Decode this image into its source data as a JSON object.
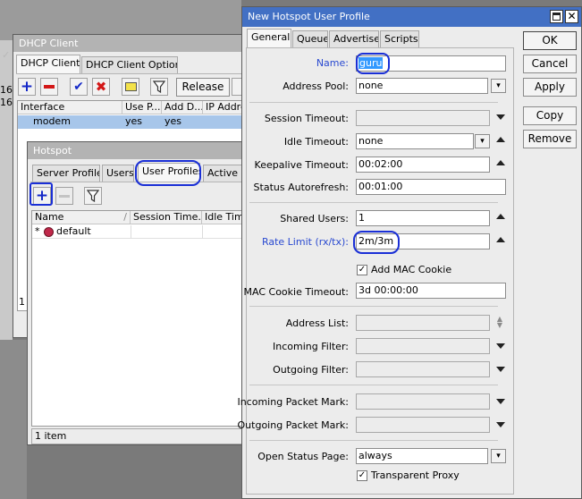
{
  "dhcp": {
    "title": "DHCP Client",
    "tabs": [
      "DHCP Client",
      "DHCP Client Options"
    ],
    "release_label": "Release",
    "columns": [
      "Interface",
      "Use P...",
      "Add D...",
      "IP Address"
    ],
    "row": [
      "modem",
      "yes",
      "yes",
      ""
    ],
    "edge_digits": [
      "16",
      "16"
    ],
    "footer_digit": "1"
  },
  "hotspot": {
    "title": "Hotspot",
    "tabs": [
      "Server Profiles",
      "Users",
      "User Profiles",
      "Active"
    ],
    "columns": [
      "Name",
      "Session Time...",
      "Idle Time"
    ],
    "row_marker": "*",
    "row_name": "default",
    "status": "1 item"
  },
  "dialog": {
    "title": "New Hotspot User Profile",
    "tabs": [
      "General",
      "Queue",
      "Advertise",
      "Scripts"
    ],
    "buttons": [
      "OK",
      "Cancel",
      "Apply",
      "Copy",
      "Remove"
    ],
    "labels": {
      "name": "Name:",
      "address_pool": "Address Pool:",
      "session_timeout": "Session Timeout:",
      "idle_timeout": "Idle Timeout:",
      "keepalive_timeout": "Keepalive Timeout:",
      "status_autorefresh": "Status Autorefresh:",
      "shared_users": "Shared Users:",
      "rate_limit": "Rate Limit (rx/tx):",
      "add_mac_cookie": "Add MAC Cookie",
      "mac_cookie_timeout": "MAC Cookie Timeout:",
      "address_list": "Address List:",
      "incoming_filter": "Incoming Filter:",
      "outgoing_filter": "Outgoing Filter:",
      "incoming_packet_mark": "Incoming Packet Mark:",
      "outgoing_packet_mark": "Outgoing Packet Mark:",
      "open_status_page": "Open Status Page:",
      "transparent_proxy": "Transparent Proxy"
    },
    "values": {
      "name": "guru",
      "address_pool": "none",
      "session_timeout": "",
      "idle_timeout": "none",
      "keepalive_timeout": "00:02:00",
      "status_autorefresh": "00:01:00",
      "shared_users": "1",
      "rate_limit": "2m/3m",
      "add_mac_cookie": true,
      "mac_cookie_timeout": "3d 00:00:00",
      "address_list": "",
      "incoming_filter": "",
      "outgoing_filter": "",
      "incoming_packet_mark": "",
      "outgoing_packet_mark": "",
      "open_status_page": "always",
      "transparent_proxy": true
    }
  },
  "colors": {
    "titlebar_active": "#4270c4",
    "label_highlight": "#2949d0",
    "selection_row": "#a7c6ea",
    "annotation_ring": "#1a2fd6"
  }
}
